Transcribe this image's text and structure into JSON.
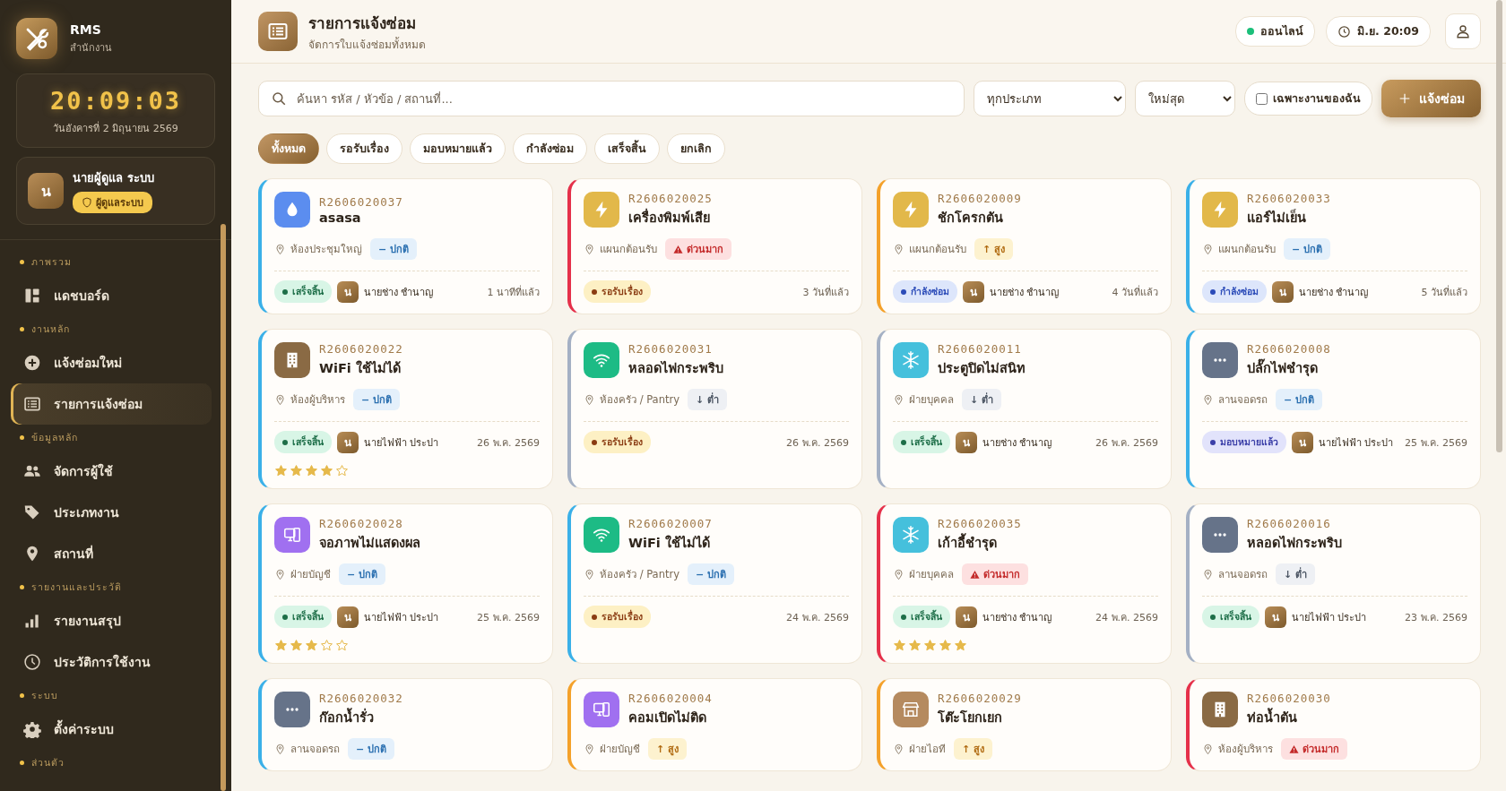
{
  "sidebar": {
    "brand": {
      "title": "RMS",
      "subtitle": "สำนักงาน"
    },
    "clock": {
      "time": "20:09:03",
      "date": "วันอังคารที่ 2 มิถุนายน 2569"
    },
    "user": {
      "initial": "น",
      "name": "นายผู้ดูแล ระบบ",
      "role": "ผู้ดูแลระบบ"
    },
    "sections": [
      {
        "label": "ภาพรวม",
        "items": [
          {
            "label": "แดชบอร์ด",
            "selected": false
          }
        ]
      },
      {
        "label": "งานหลัก",
        "items": [
          {
            "label": "แจ้งซ่อมใหม่",
            "selected": false
          },
          {
            "label": "รายการแจ้งซ่อม",
            "selected": true
          }
        ]
      },
      {
        "label": "ข้อมูลหลัก",
        "items": [
          {
            "label": "จัดการผู้ใช้",
            "selected": false
          },
          {
            "label": "ประเภทงาน",
            "selected": false
          },
          {
            "label": "สถานที่",
            "selected": false
          }
        ]
      },
      {
        "label": "รายงานและประวัติ",
        "items": [
          {
            "label": "รายงานสรุป",
            "selected": false
          },
          {
            "label": "ประวัติการใช้งาน",
            "selected": false
          }
        ]
      },
      {
        "label": "ระบบ",
        "items": [
          {
            "label": "ตั้งค่าระบบ",
            "selected": false
          }
        ]
      },
      {
        "label": "ส่วนตัว"
      }
    ]
  },
  "header": {
    "title": "รายการแจ้งซ่อม",
    "subtitle": "จัดการใบแจ้งซ่อมทั้งหมด",
    "status": "ออนไลน์",
    "clock": "มิ.ย. 20:09"
  },
  "filters": {
    "search_placeholder": "ค้นหา รหัส / หัวข้อ / สถานที่...",
    "type_select": "ทุกประเภท",
    "sort_select": "ใหม่สุด",
    "mine_only": {
      "label": "เฉพาะงานของฉัน",
      "checked": false
    },
    "new_button": "แจ้งซ่อม"
  },
  "tabs": [
    {
      "label": "ทั้งหมด",
      "selected": true
    },
    {
      "label": "รอรับเรื่อง",
      "selected": false
    },
    {
      "label": "มอบหมายแล้ว",
      "selected": false
    },
    {
      "label": "กำลังซ่อม",
      "selected": false
    },
    {
      "label": "เสร็จสิ้น",
      "selected": false
    },
    {
      "label": "ยกเลิก",
      "selected": false
    }
  ],
  "tickets": [
    {
      "code": "R2606020037",
      "title": "asasa",
      "kind": "water",
      "location": "ห้องประชุมใหญ่",
      "priority": {
        "kind": "normal",
        "label": "− ปกติ"
      },
      "status": {
        "kind": "done",
        "label": "เสร็จสิ้น"
      },
      "tech_initial": "น",
      "technician": "นายช่าง ชำนาญ",
      "time": "1 นาทีที่แล้ว"
    },
    {
      "code": "R2606020025",
      "title": "เครื่องพิมพ์เสีย",
      "kind": "bolt",
      "location": "แผนกต้อนรับ",
      "priority": {
        "kind": "urgent",
        "label": "ด่วนมาก"
      },
      "status": {
        "kind": "pending",
        "label": "รอรับเรื่อง"
      },
      "time": "3 วันที่แล้ว"
    },
    {
      "code": "R2606020009",
      "title": "ชักโครกตัน",
      "kind": "bolt",
      "location": "แผนกต้อนรับ",
      "priority": {
        "kind": "high",
        "label": "↑ สูง"
      },
      "status": {
        "kind": "repairing",
        "label": "กำลังซ่อม"
      },
      "tech_initial": "น",
      "technician": "นายช่าง ชำนาญ",
      "time": "4 วันที่แล้ว"
    },
    {
      "code": "R2606020033",
      "title": "แอร์ไม่เย็น",
      "kind": "bolt",
      "location": "แผนกต้อนรับ",
      "priority": {
        "kind": "normal",
        "label": "− ปกติ"
      },
      "status": {
        "kind": "repairing",
        "label": "กำลังซ่อม"
      },
      "tech_initial": "น",
      "technician": "นายช่าง ชำนาญ",
      "time": "5 วันที่แล้ว"
    },
    {
      "code": "R2606020022",
      "title": "WiFi ใช้ไม่ได้",
      "kind": "building",
      "location": "ห้องผู้บริหาร",
      "priority": {
        "kind": "normal",
        "label": "− ปกติ"
      },
      "status": {
        "kind": "done",
        "label": "เสร็จสิ้น"
      },
      "tech_initial": "น",
      "technician": "นายไฟฟ้า ประปา",
      "time": "26 พ.ค. 2569",
      "stars": 4
    },
    {
      "code": "R2606020031",
      "title": "หลอดไฟกระพริบ",
      "kind": "wifi",
      "location": "ห้องครัว / Pantry",
      "priority": {
        "kind": "low",
        "label": "↓ ต่ำ"
      },
      "status": {
        "kind": "pending",
        "label": "รอรับเรื่อง"
      },
      "time": "26 พ.ค. 2569"
    },
    {
      "code": "R2606020011",
      "title": "ประตูปิดไม่สนิท",
      "kind": "snow",
      "location": "ฝ่ายบุคคล",
      "priority": {
        "kind": "low",
        "label": "↓ ต่ำ"
      },
      "status": {
        "kind": "done",
        "label": "เสร็จสิ้น"
      },
      "tech_initial": "น",
      "technician": "นายช่าง ชำนาญ",
      "time": "26 พ.ค. 2569"
    },
    {
      "code": "R2606020008",
      "title": "ปลั๊กไฟชำรุด",
      "kind": "other",
      "location": "ลานจอดรถ",
      "priority": {
        "kind": "normal",
        "label": "− ปกติ"
      },
      "status": {
        "kind": "assigned",
        "label": "มอบหมายแล้ว"
      },
      "tech_initial": "น",
      "technician": "นายไฟฟ้า ประปา",
      "time": "25 พ.ค. 2569"
    },
    {
      "code": "R2606020028",
      "title": "จอภาพไม่แสดงผล",
      "kind": "device",
      "location": "ฝ่ายบัญชี",
      "priority": {
        "kind": "normal",
        "label": "− ปกติ"
      },
      "status": {
        "kind": "done",
        "label": "เสร็จสิ้น"
      },
      "tech_initial": "น",
      "technician": "นายไฟฟ้า ประปา",
      "time": "25 พ.ค. 2569",
      "stars": 3
    },
    {
      "code": "R2606020007",
      "title": "WiFi ใช้ไม่ได้",
      "kind": "wifi",
      "location": "ห้องครัว / Pantry",
      "priority": {
        "kind": "normal",
        "label": "− ปกติ"
      },
      "status": {
        "kind": "pending",
        "label": "รอรับเรื่อง"
      },
      "time": "24 พ.ค. 2569"
    },
    {
      "code": "R2606020035",
      "title": "เก้าอี้ชำรุด",
      "kind": "snow",
      "location": "ฝ่ายบุคคล",
      "priority": {
        "kind": "urgent",
        "label": "ด่วนมาก"
      },
      "status": {
        "kind": "done",
        "label": "เสร็จสิ้น"
      },
      "tech_initial": "น",
      "technician": "นายช่าง ชำนาญ",
      "time": "24 พ.ค. 2569",
      "stars": 5
    },
    {
      "code": "R2606020016",
      "title": "หลอดไฟกระพริบ",
      "kind": "other",
      "location": "ลานจอดรถ",
      "priority": {
        "kind": "low",
        "label": "↓ ต่ำ"
      },
      "status": {
        "kind": "done",
        "label": "เสร็จสิ้น"
      },
      "tech_initial": "น",
      "technician": "นายไฟฟ้า ประปา",
      "time": "23 พ.ค. 2569"
    },
    {
      "code": "R2606020032",
      "title": "ก๊อกน้ำรั่ว",
      "kind": "other",
      "location": "ลานจอดรถ",
      "priority": {
        "kind": "normal",
        "label": "− ปกติ"
      }
    },
    {
      "code": "R2606020004",
      "title": "คอมเปิดไม่ติด",
      "kind": "device",
      "location": "ฝ่ายบัญชี",
      "priority": {
        "kind": "high",
        "label": "↑ สูง"
      }
    },
    {
      "code": "R2606020029",
      "title": "โต๊ะโยกเยก",
      "kind": "store",
      "location": "ฝ่ายไอที",
      "priority": {
        "kind": "high",
        "label": "↑ สูง"
      }
    },
    {
      "code": "R2606020030",
      "title": "ท่อน้ำตัน",
      "kind": "building",
      "location": "ห้องผู้บริหาร",
      "priority": {
        "kind": "urgent",
        "label": "ด่วนมาก"
      }
    }
  ]
}
